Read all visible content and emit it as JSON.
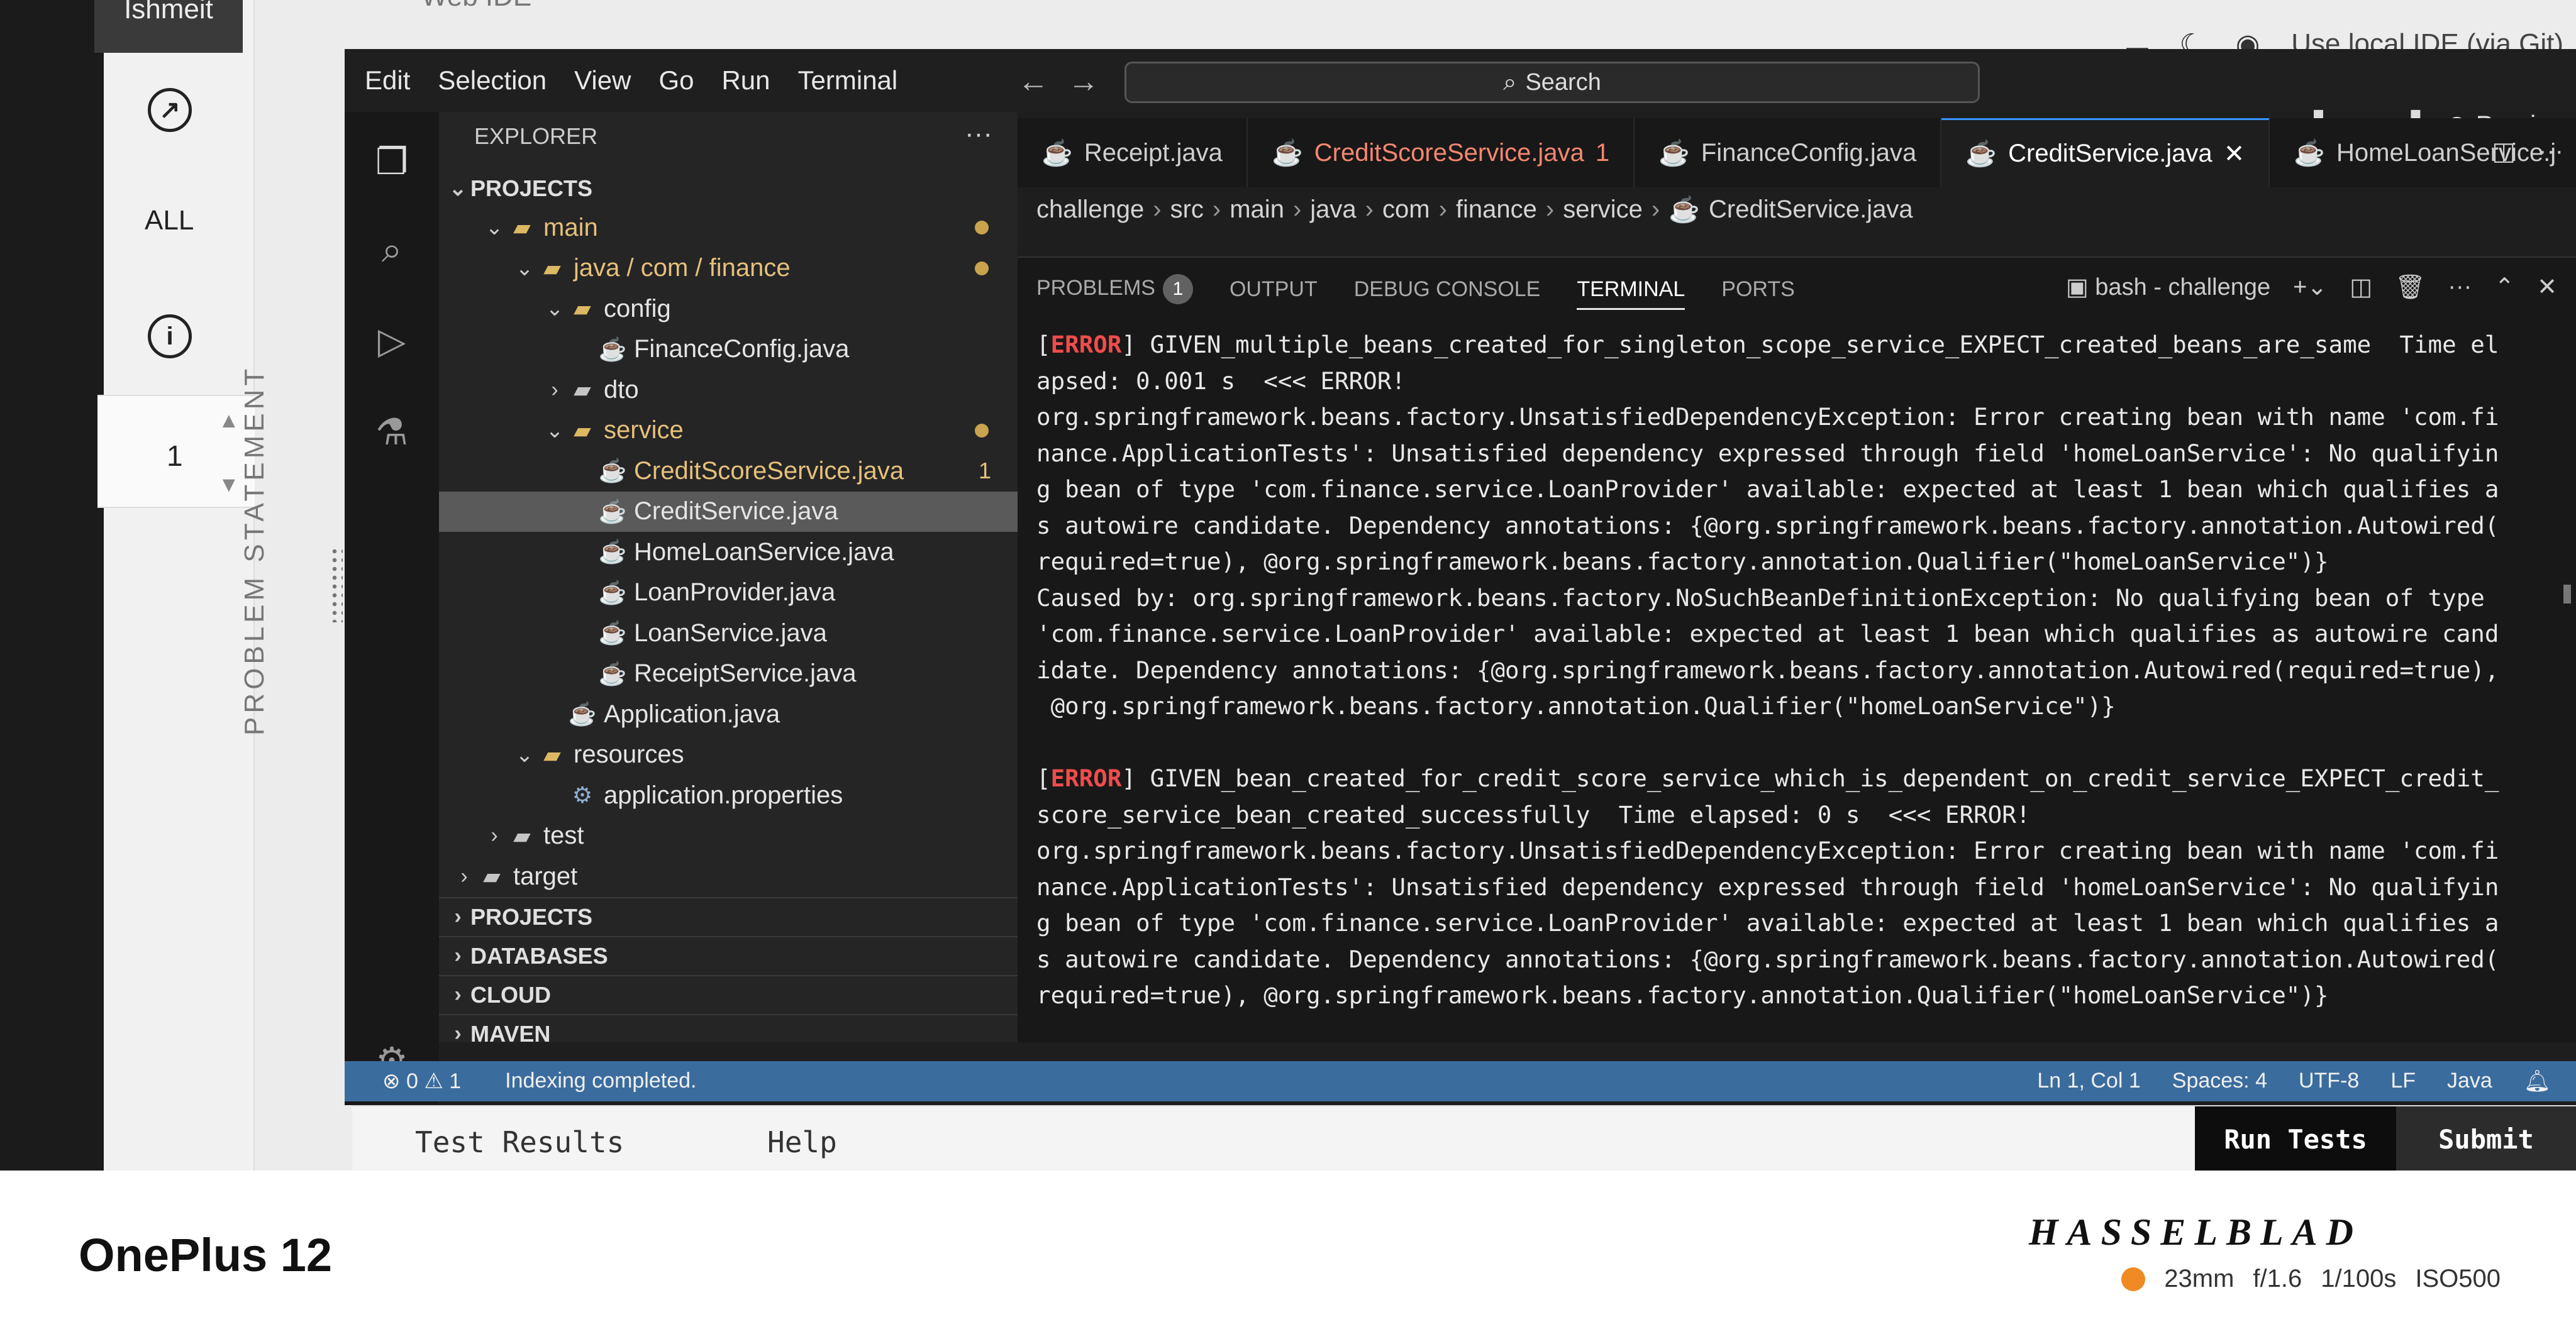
{
  "page": {
    "title": "Web IDE",
    "top_right": {
      "use_local_ide": "Use local IDE (via Git)"
    },
    "left_nav": {
      "tab_text": "Ishmeit",
      "all_label": "ALL",
      "counter_value": "1",
      "problem_statement": "PROBLEM STATEMENT"
    }
  },
  "menu": [
    "Edit",
    "Selection",
    "View",
    "Go",
    "Run",
    "Terminal"
  ],
  "search": {
    "label": "Search"
  },
  "preview": {
    "label": "Preview"
  },
  "explorer": {
    "header": "EXPLORER",
    "more": "···",
    "section": "PROJECTS",
    "items": [
      {
        "label": "main",
        "type": "folder-open",
        "depth": 1,
        "modified": true
      },
      {
        "label": "java / com / finance",
        "type": "folder-open",
        "depth": 2,
        "modified": true
      },
      {
        "label": "config",
        "type": "folder-open",
        "depth": 3
      },
      {
        "label": "FinanceConfig.java",
        "type": "java",
        "depth": 4
      },
      {
        "label": "dto",
        "type": "folder",
        "depth": 3
      },
      {
        "label": "service",
        "type": "folder-open",
        "depth": 3,
        "modified": true
      },
      {
        "label": "CreditScoreService.java",
        "type": "java",
        "depth": 4,
        "modified": true,
        "badge": "1"
      },
      {
        "label": "CreditService.java",
        "type": "java",
        "depth": 4,
        "selected": true
      },
      {
        "label": "HomeLoanService.java",
        "type": "java",
        "depth": 4
      },
      {
        "label": "LoanProvider.java",
        "type": "java",
        "depth": 4
      },
      {
        "label": "LoanService.java",
        "type": "java",
        "depth": 4
      },
      {
        "label": "ReceiptService.java",
        "type": "java",
        "depth": 4
      },
      {
        "label": "Application.java",
        "type": "java",
        "depth": 3
      },
      {
        "label": "resources",
        "type": "folder-open",
        "depth": 2
      },
      {
        "label": "application.properties",
        "type": "gear",
        "depth": 3
      },
      {
        "label": "test",
        "type": "folder",
        "depth": 1
      },
      {
        "label": "target",
        "type": "folder",
        "depth": 0
      }
    ],
    "bottom_sections": [
      "PROJECTS",
      "DATABASES",
      "CLOUD",
      "MAVEN"
    ]
  },
  "tabs": [
    {
      "label": "Receipt.java"
    },
    {
      "label": "CreditScoreService.java",
      "suffix": "1",
      "error": true
    },
    {
      "label": "FinanceConfig.java"
    },
    {
      "label": "CreditService.java",
      "active": true
    },
    {
      "label": "HomeLoanService.j"
    }
  ],
  "breadcrumb": [
    "challenge",
    "src",
    "main",
    "java",
    "com",
    "finance",
    "service",
    "CreditService.java"
  ],
  "panel": {
    "tabs": [
      "PROBLEMS",
      "OUTPUT",
      "DEBUG CONSOLE",
      "TERMINAL",
      "PORTS"
    ],
    "problems_count": "1",
    "active_tab": "TERMINAL",
    "terminal_name": "bash - challenge"
  },
  "terminal_lines": [
    {
      "prefix": "[",
      "tag": "ERROR",
      "text": "] GIVEN_multiple_beans_created_for_singleton_scope_service_EXPECT_created_beans_are_same  Time el"
    },
    {
      "text": "apsed: 0.001 s  <<< ERROR!"
    },
    {
      "text": "org.springframework.beans.factory.UnsatisfiedDependencyException: Error creating bean with name 'com.fi"
    },
    {
      "text": "nance.ApplicationTests': Unsatisfied dependency expressed through field 'homeLoanService': No qualifyin"
    },
    {
      "text": "g bean of type 'com.finance.service.LoanProvider' available: expected at least 1 bean which qualifies a"
    },
    {
      "text": "s autowire candidate. Dependency annotations: {@org.springframework.beans.factory.annotation.Autowired("
    },
    {
      "text": "required=true), @org.springframework.beans.factory.annotation.Qualifier(\"homeLoanService\")}"
    },
    {
      "text": "Caused by: org.springframework.beans.factory.NoSuchBeanDefinitionException: No qualifying bean of type"
    },
    {
      "text": "'com.finance.service.LoanProvider' available: expected at least 1 bean which qualifies as autowire cand"
    },
    {
      "text": "idate. Dependency annotations: {@org.springframework.beans.factory.annotation.Autowired(required=true),"
    },
    {
      "text": " @org.springframework.beans.factory.annotation.Qualifier(\"homeLoanService\")}"
    },
    {
      "text": ""
    },
    {
      "prefix": "[",
      "tag": "ERROR",
      "text": "] GIVEN_bean_created_for_credit_score_service_which_is_dependent_on_credit_service_EXPECT_credit_"
    },
    {
      "text": "score_service_bean_created_successfully  Time elapsed: 0 s  <<< ERROR!"
    },
    {
      "text": "org.springframework.beans.factory.UnsatisfiedDependencyException: Error creating bean with name 'com.fi"
    },
    {
      "text": "nance.ApplicationTests': Unsatisfied dependency expressed through field 'homeLoanService': No qualifyin"
    },
    {
      "text": "g bean of type 'com.finance.service.LoanProvider' available: expected at least 1 bean which qualifies a"
    },
    {
      "text": "s autowire candidate. Dependency annotations: {@org.springframework.beans.factory.annotation.Autowired("
    },
    {
      "text": "required=true), @org.springframework.beans.factory.annotation.Qualifier(\"homeLoanService\")}"
    }
  ],
  "statusbar": {
    "errors": "0",
    "warnings": "1",
    "message": "Indexing completed.",
    "position": "Ln 1, Col 1",
    "spaces": "Spaces: 4",
    "encoding": "UTF-8",
    "eol": "LF",
    "language": "Java"
  },
  "bottom": {
    "test_results": "Test Results",
    "help": "Help",
    "run_tests": "Run Tests",
    "submit": "Submit"
  },
  "watermark": {
    "device": "OnePlus 12",
    "brand": "HASSELBLAD",
    "focal": "23mm",
    "aperture": "f/1.6",
    "shutter": "1/100s",
    "iso": "ISO500"
  }
}
